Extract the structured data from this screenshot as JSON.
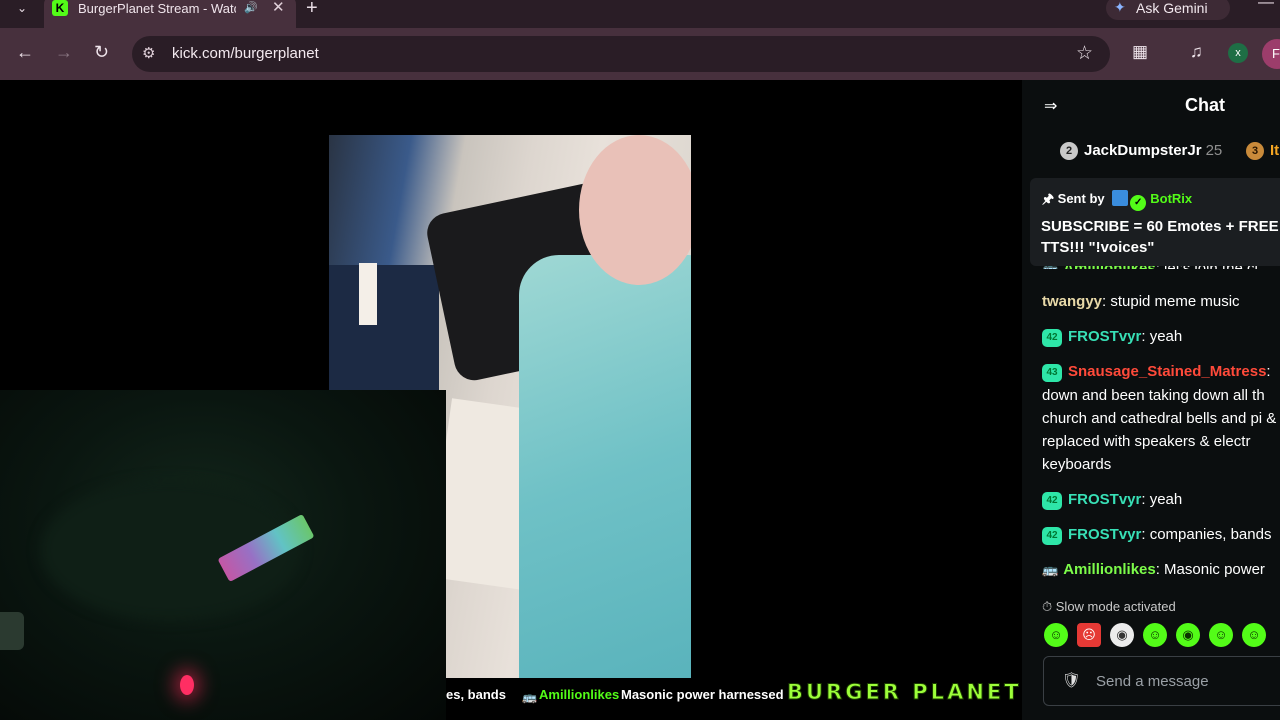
{
  "browser": {
    "tab": {
      "title": "BurgerPlanet Stream - Watch",
      "favicon": "K"
    },
    "gemini_label": "Ask Gemini",
    "url": "kick.com/burgerplanet",
    "profile_x": "x",
    "profile_f": "F"
  },
  "overlay": {
    "ticker_fragment": "es, bands",
    "ticker_user": "Amillionlikes",
    "ticker_message": "Masonic power harnessed",
    "logo_text": "BURGER PLANET"
  },
  "chat": {
    "title": "Chat",
    "top_gifters": [
      {
        "rank": "2",
        "name": "JackDumpsterJr",
        "count": "25"
      },
      {
        "rank": "3",
        "name": "It"
      }
    ],
    "pinned": {
      "sent_by_label": "Sent by",
      "bot_name": "BotRix",
      "message": "SUBSCRIBE = 60 Emotes + FREE TTS!!! \"!voices\""
    },
    "messages": [
      {
        "badge": "",
        "user": "Amillionlikes",
        "text": ": let's join the cl"
      },
      {
        "badge": "",
        "user": "twangyy",
        "text": ": stupid meme music"
      },
      {
        "badge": "42",
        "user": "FROSTvyr",
        "text": ": yeah"
      },
      {
        "badge": "43",
        "user": "Snausage_Stained_Matress",
        "text": ":",
        "continuation": "down and been taking down all th church and cathedral bells and pi & replaced with speakers & electr keyboards"
      },
      {
        "badge": "42",
        "user": "FROSTvyr",
        "text": ": yeah"
      },
      {
        "badge": "42",
        "user": "FROSTvyr",
        "text": ": companies, bands"
      },
      {
        "badge": "",
        "user": "Amillionlikes",
        "text": ": Masonic power"
      }
    ],
    "slow_mode": "Slow mode activated",
    "input_placeholder": "Send a message"
  },
  "colors": {
    "kick_green": "#53fc18",
    "chrome_toolbar": "#47303d",
    "chat_bg": "#0b0e0f"
  }
}
